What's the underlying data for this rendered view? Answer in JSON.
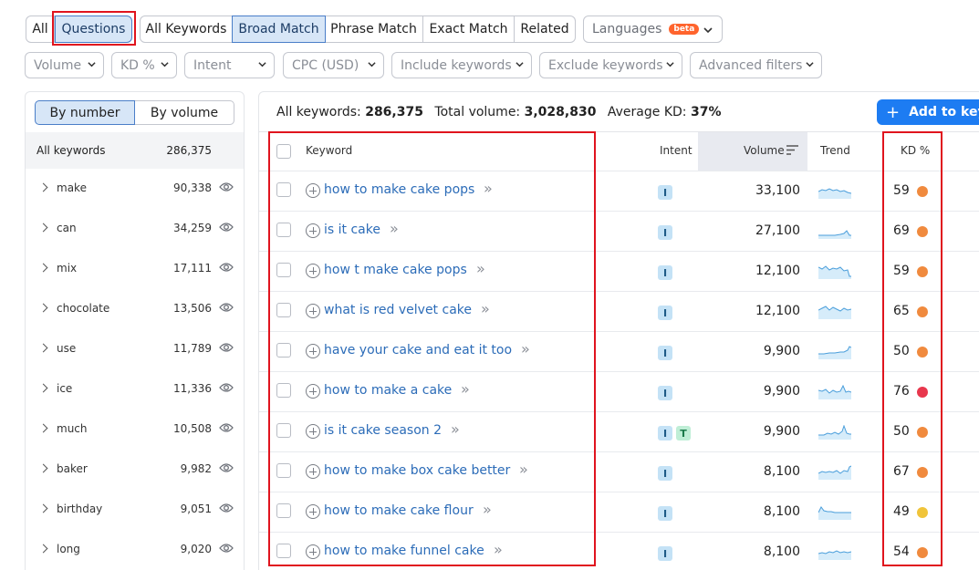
{
  "tabs": [
    {
      "label": "All",
      "active": false
    },
    {
      "label": "Questions",
      "active": true
    },
    {
      "label": "All Keywords",
      "active": false
    },
    {
      "label": "Broad Match",
      "active": true
    },
    {
      "label": "Phrase Match",
      "active": false
    },
    {
      "label": "Exact Match",
      "active": false
    },
    {
      "label": "Related",
      "active": false
    }
  ],
  "languages": {
    "label": "Languages",
    "badge": "beta"
  },
  "filters": [
    "Volume",
    "KD %",
    "Intent",
    "CPC (USD)",
    "Include keywords",
    "Exclude keywords",
    "Advanced filters"
  ],
  "sidebar": {
    "toggle": [
      "By number",
      "By volume"
    ],
    "all": {
      "label": "All keywords",
      "count": "286,375"
    },
    "items": [
      {
        "label": "make",
        "count": "90,338"
      },
      {
        "label": "can",
        "count": "34,259"
      },
      {
        "label": "mix",
        "count": "17,111"
      },
      {
        "label": "chocolate",
        "count": "13,506"
      },
      {
        "label": "use",
        "count": "11,789"
      },
      {
        "label": "ice",
        "count": "11,336"
      },
      {
        "label": "much",
        "count": "10,508"
      },
      {
        "label": "baker",
        "count": "9,982"
      },
      {
        "label": "birthday",
        "count": "9,051"
      },
      {
        "label": "long",
        "count": "9,020"
      }
    ]
  },
  "summary": {
    "all_label": "All keywords:",
    "all_value": "286,375",
    "volume_label": "Total volume:",
    "volume_value": "3,028,830",
    "kd_label": "Average KD:",
    "kd_value": "37%"
  },
  "add_button": "Add to keyw",
  "table": {
    "headers": {
      "keyword": "Keyword",
      "intent": "Intent",
      "volume": "Volume",
      "trend": "Trend",
      "kd": "KD %"
    },
    "rows": [
      {
        "keyword": "how to make cake pops",
        "intent": [
          "I"
        ],
        "volume": "33,100",
        "kd": "59",
        "kd_color": "#f08a3e"
      },
      {
        "keyword": "is it cake",
        "intent": [
          "I"
        ],
        "volume": "27,100",
        "kd": "69",
        "kd_color": "#f08a3e"
      },
      {
        "keyword": "how t make cake pops",
        "intent": [
          "I"
        ],
        "volume": "12,100",
        "kd": "59",
        "kd_color": "#f08a3e"
      },
      {
        "keyword": "what is red velvet cake",
        "intent": [
          "I"
        ],
        "volume": "12,100",
        "kd": "65",
        "kd_color": "#f08a3e"
      },
      {
        "keyword": "have your cake and eat it too",
        "intent": [
          "I"
        ],
        "volume": "9,900",
        "kd": "50",
        "kd_color": "#f08a3e"
      },
      {
        "keyword": "how to make a cake",
        "intent": [
          "I"
        ],
        "volume": "9,900",
        "kd": "76",
        "kd_color": "#e8374d"
      },
      {
        "keyword": "is it cake season 2",
        "intent": [
          "I",
          "T"
        ],
        "volume": "9,900",
        "kd": "50",
        "kd_color": "#f08a3e"
      },
      {
        "keyword": "how to make box cake better",
        "intent": [
          "I"
        ],
        "volume": "8,100",
        "kd": "67",
        "kd_color": "#f08a3e"
      },
      {
        "keyword": "how to make cake flour",
        "intent": [
          "I"
        ],
        "volume": "8,100",
        "kd": "49",
        "kd_color": "#f0c43a"
      },
      {
        "keyword": "how to make funnel cake",
        "intent": [
          "I"
        ],
        "volume": "8,100",
        "kd": "54",
        "kd_color": "#f08a3e"
      }
    ]
  },
  "colors": {
    "accent": "#1d7cf2",
    "highlight": "#e0141e",
    "link": "#2c6cb8"
  }
}
